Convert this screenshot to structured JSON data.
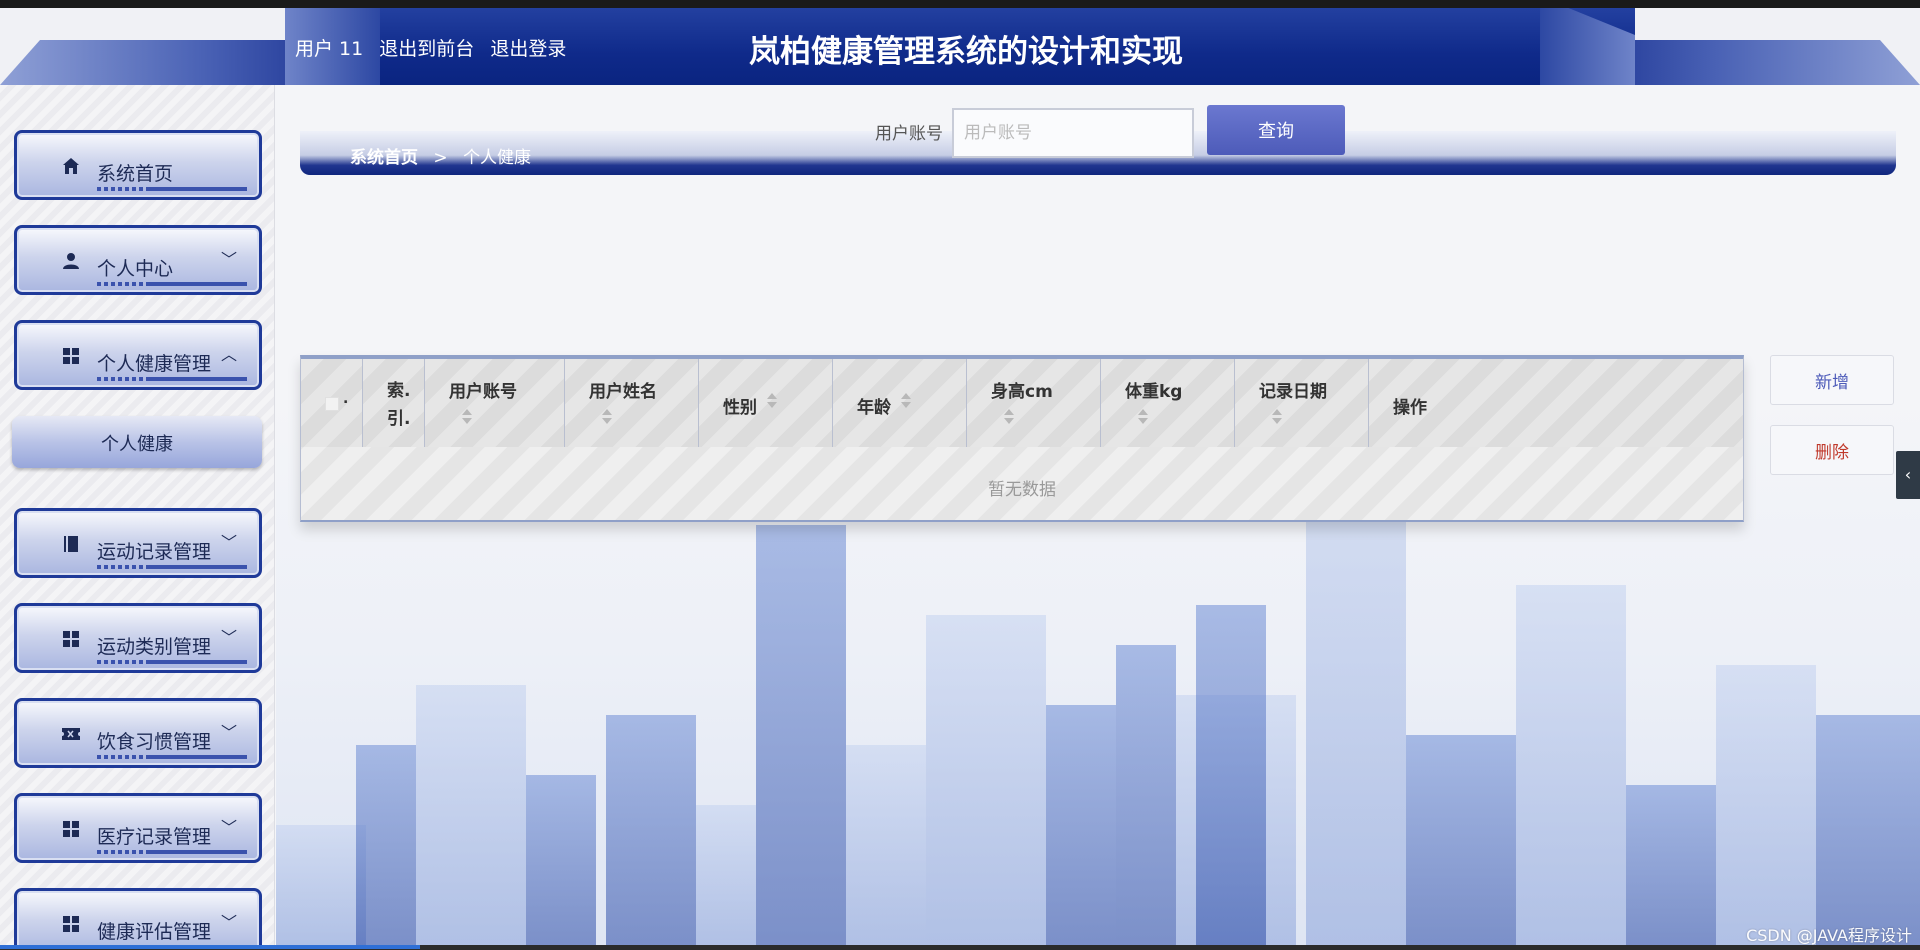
{
  "header": {
    "user_label": "用户 11",
    "to_front": "退出到前台",
    "logout": "退出登录",
    "title": "岚柏健康管理系统的设计和实现"
  },
  "sidebar": {
    "items": [
      {
        "label": "系统首页",
        "icon": "home-icon"
      },
      {
        "label": "个人中心",
        "icon": "user-icon",
        "chevron": "﹀"
      },
      {
        "label": "个人健康管理",
        "icon": "grid-icon",
        "chevron": "︿"
      },
      {
        "label": "运动记录管理",
        "icon": "book-icon",
        "chevron": "﹀"
      },
      {
        "label": "运动类别管理",
        "icon": "grid-icon",
        "chevron": "﹀"
      },
      {
        "label": "饮食习惯管理",
        "icon": "ticket-icon",
        "chevron": "﹀"
      },
      {
        "label": "医疗记录管理",
        "icon": "grid-icon",
        "chevron": "﹀"
      },
      {
        "label": "健康评估管理",
        "icon": "grid-icon",
        "chevron": "﹀"
      }
    ],
    "submenu": {
      "label": "个人健康"
    }
  },
  "breadcrumb": {
    "home": "系统首页",
    "sep": ">",
    "current": "个人健康"
  },
  "search": {
    "label": "用户账号",
    "placeholder": "用户账号",
    "button": "查询"
  },
  "actions": {
    "add": "新增",
    "delete": "删除"
  },
  "table": {
    "check_suffix": ".",
    "index_header": "索.\n引.",
    "columns": [
      "用户账号",
      "用户姓名",
      "性别",
      "年龄",
      "身高cm",
      "体重kg",
      "记录日期",
      "操作"
    ],
    "empty_text": "暂无数据"
  },
  "watermark": "CSDN @JAVA程序设计",
  "colors": {
    "primary": "#0f2a8a",
    "button": "#4d5bb9",
    "danger": "#c0392b"
  }
}
